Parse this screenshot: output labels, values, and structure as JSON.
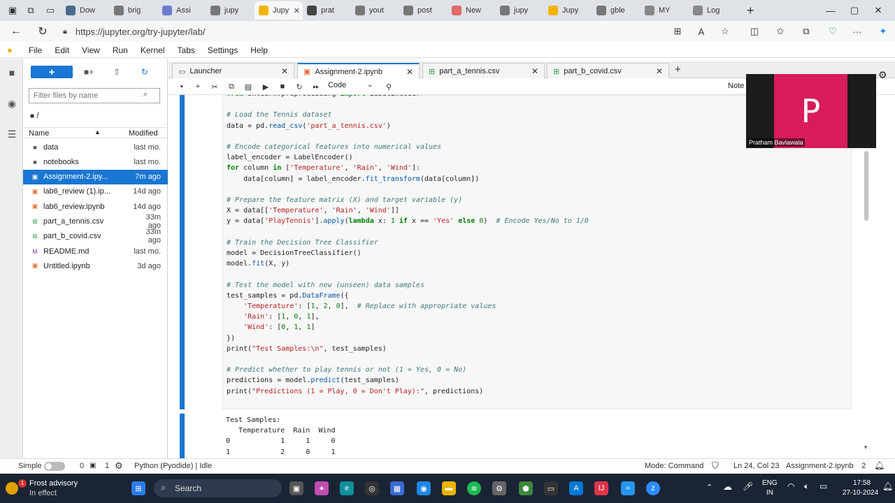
{
  "browser": {
    "tabs": [
      {
        "label": "Dow",
        "icon": "browser-tab-icon",
        "color": "#4a6b8a"
      },
      {
        "label": "brig",
        "icon": "search-icon",
        "color": "#777777"
      },
      {
        "label": "Assi",
        "icon": "doc-icon",
        "color": "#6b7ccf"
      },
      {
        "label": "jupy",
        "icon": "search-icon",
        "color": "#777777"
      },
      {
        "label": "Jupy",
        "icon": "jupyter-icon",
        "color": "#f2b400"
      },
      {
        "label": "prat",
        "icon": "github-icon",
        "color": "#444444"
      },
      {
        "label": "yout",
        "icon": "search-icon",
        "color": "#777777"
      },
      {
        "label": "post",
        "icon": "search-icon",
        "color": "#777777"
      },
      {
        "label": "New",
        "icon": "new-tab-icon",
        "color": "#e06a6a"
      },
      {
        "label": "jupy",
        "icon": "search-icon",
        "color": "#777777"
      },
      {
        "label": "Jupy",
        "icon": "jupyter-icon",
        "color": "#f2b400"
      },
      {
        "label": "gble",
        "icon": "search-icon",
        "color": "#777777"
      },
      {
        "label": "MY",
        "icon": "page-icon",
        "color": "#888888"
      },
      {
        "label": "Log",
        "icon": "page-icon",
        "color": "#888888"
      }
    ],
    "url": "https://jupyter.org/try-jupyter/lab/"
  },
  "menubar": [
    "File",
    "Edit",
    "View",
    "Run",
    "Kernel",
    "Tabs",
    "Settings",
    "Help"
  ],
  "filebrowser": {
    "filter_placeholder": "Filter files by name",
    "breadcrumb": "/",
    "col_name": "Name",
    "col_modified": "Modified",
    "files": [
      {
        "name": "data",
        "modified": "last mo.",
        "type": "folder"
      },
      {
        "name": "notebooks",
        "modified": "last mo.",
        "type": "folder"
      },
      {
        "name": "Assignment-2.ipy...",
        "modified": "7m ago",
        "type": "notebook",
        "selected": true
      },
      {
        "name": "lab6_review (1).ip...",
        "modified": "14d ago",
        "type": "notebook"
      },
      {
        "name": "lab6_review.ipynb",
        "modified": "14d ago",
        "type": "notebook"
      },
      {
        "name": "part_a_tennis.csv",
        "modified": "33m ago",
        "type": "csv"
      },
      {
        "name": "part_b_covid.csv",
        "modified": "33m ago",
        "type": "csv"
      },
      {
        "name": "README.md",
        "modified": "last mo.",
        "type": "markdown"
      },
      {
        "name": "Untitled.ipynb",
        "modified": "3d ago",
        "type": "notebook"
      }
    ]
  },
  "dock_tabs": [
    {
      "label": "Launcher",
      "active": false
    },
    {
      "label": "Assignment-2.ipynb",
      "active": true
    },
    {
      "label": "part_a_tennis.csv",
      "active": false
    },
    {
      "label": "part_b_covid.csv",
      "active": false
    }
  ],
  "notebook_toolbar": {
    "cell_type": "Code",
    "note_label": "Note"
  },
  "code_lines": [
    "from sklearn.preprocessing import LabelEncoder",
    "",
    "# Load the Tennis dataset",
    "data = pd.read_csv('part_a_tennis.csv')",
    "",
    "# Encode categorical features into numerical values",
    "label_encoder = LabelEncoder()",
    "for column in ['Temperature', 'Rain', 'Wind']:",
    "    data[column] = label_encoder.fit_transform(data[column])",
    "",
    "# Prepare the feature matrix (X) and target variable (y)",
    "X = data[['Temperature', 'Rain', 'Wind']]",
    "y = data['PlayTennis'].apply(lambda x: 1 if x == 'Yes' else 0)  # Encode Yes/No to 1/0",
    "",
    "# Train the Decision Tree Classifier",
    "model = DecisionTreeClassifier()",
    "model.fit(X, y)",
    "",
    "# Test the model with new (unseen) data samples",
    "test_samples = pd.DataFrame({",
    "    'Temperature': [1, 2, 0],  # Replace with appropriate values",
    "    'Rain': [1, 0, 1],",
    "    'Wind': [0, 1, 1]",
    "})",
    "print(\"Test Samples:\\n\", test_samples)",
    "",
    "# Predict whether to play tennis or not (1 = Yes, 0 = No)",
    "predictions = model.predict(test_samples)",
    "print(\"Predictions (1 = Play, 0 = Don't Play):\", predictions)"
  ],
  "output_lines": [
    "Test Samples:",
    "   Temperature  Rain  Wind",
    "0            1     1     0",
    "1            2     0     1"
  ],
  "video": {
    "initial": "P",
    "name": "Pratham Bavlawala",
    "color": "#d81b5b"
  },
  "statusbar": {
    "mode_label": "Simple",
    "count_a": "0",
    "count_b": "1",
    "kernel": "Python (Pyodide) | Idle",
    "mode": "Mode: Command",
    "cursor": "Ln 24, Col 23",
    "file": "Assignment-2.ipynb",
    "num": "2"
  },
  "taskbar": {
    "notif_title": "Frost advisory",
    "notif_sub": "In effect",
    "notif_badge": "1",
    "search": "Search",
    "lang": "ENG",
    "region": "IN",
    "time": "17:58",
    "date": "27-10-2024"
  },
  "colors": {
    "accent": "#1976d2",
    "browser_bg": "#dfe3e8",
    "taskbar": "#1b2434"
  }
}
